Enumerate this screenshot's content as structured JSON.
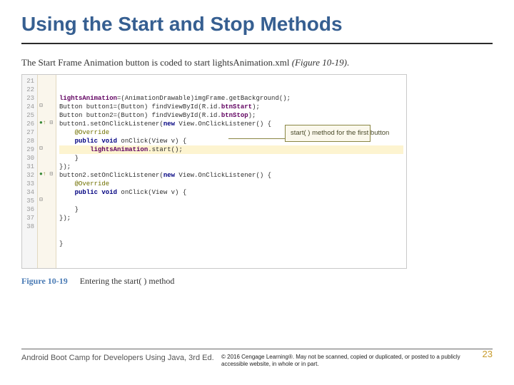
{
  "title": "Using the Start and Stop Methods",
  "intro_pre": "The Start Frame Animation button is coded to start lightsAnimation.xml ",
  "intro_ref": "(Figure 10-19)",
  "intro_post": ".",
  "line_numbers": [
    "21",
    "22",
    "23",
    "24",
    "25",
    "26",
    "27",
    "28",
    "29",
    "30",
    "31",
    "32",
    "33",
    "34",
    "35",
    "36",
    "37",
    "38"
  ],
  "markers": [
    "",
    "",
    "",
    "⊟",
    "",
    "●↑ ⊟",
    "",
    "",
    "⊟",
    "",
    "",
    "●↑ ⊟",
    "",
    "",
    "⊟",
    "",
    "",
    ""
  ],
  "code": [
    {
      "pre": "",
      "fld": "lightsAnimation",
      "rest": "=(AnimationDrawable)imgFrame.getBackground();"
    },
    {
      "pre": "Button button1=(Button) findViewById(R.id.",
      "fld": "btnStart",
      "rest": ");"
    },
    {
      "pre": "Button button2=(Button) findViewById(R.id.",
      "fld": "btnStop",
      "rest": ");"
    },
    {
      "pre": "button1.setOnClickListener(",
      "kw": "new",
      "rest": " View.OnClickListener() {"
    },
    {
      "ann": "    @Override"
    },
    {
      "kw": "    public void ",
      "id": "onClick",
      "rest": "(View v) {"
    },
    {
      "hl": true,
      "pre": "        ",
      "fld": "lightsAnimation",
      "rest": ".start();"
    },
    {
      "rest": "    }"
    },
    {
      "rest": "});"
    },
    {
      "pre": "button2.setOnClickListener(",
      "kw": "new",
      "rest": " View.OnClickListener() {"
    },
    {
      "ann": "    @Override"
    },
    {
      "kw": "    public void ",
      "id": "onClick",
      "rest": "(View v) {"
    },
    {
      "rest": ""
    },
    {
      "rest": "    }"
    },
    {
      "rest": "});"
    },
    {
      "rest": ""
    },
    {
      "rest": ""
    },
    {
      "rest": "}"
    }
  ],
  "callout": "start( ) method for the first button",
  "figure_num": "Figure 10-19",
  "figure_cap": "Entering the start( ) method",
  "footer_book": "Android Boot Camp for Developers Using Java, 3rd Ed.",
  "footer_copy": "© 2016 Cengage Learning®. May not be scanned, copied or duplicated, or posted to a publicly accessible website, in whole or in part.",
  "page_num": "23"
}
